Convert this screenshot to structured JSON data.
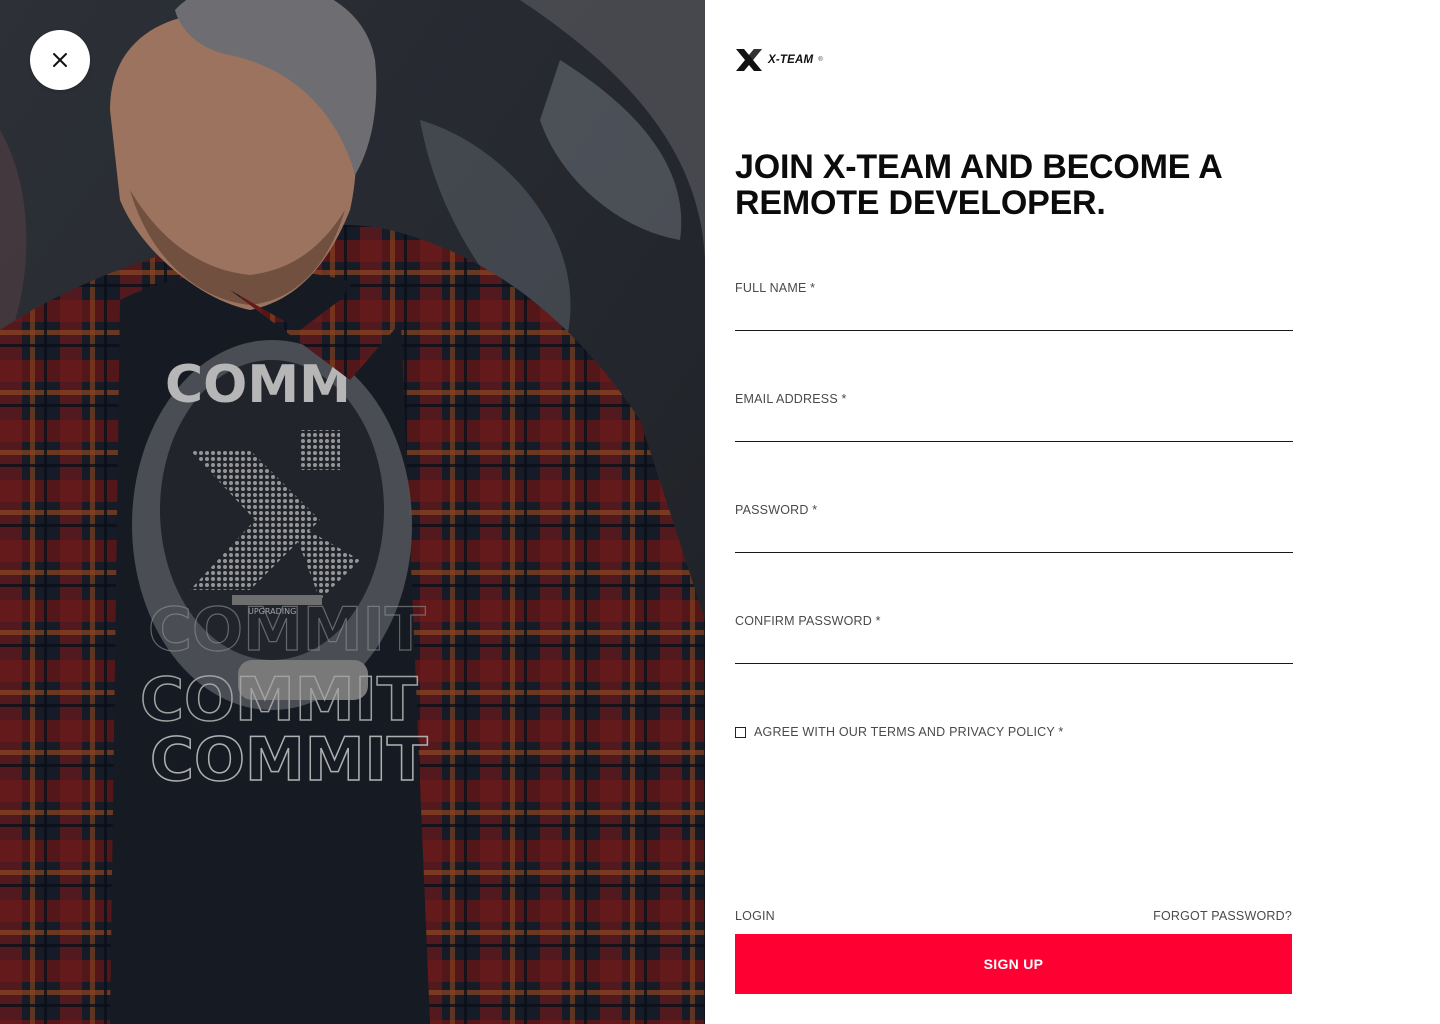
{
  "hero": {
    "photo_icon": "photo-of-developer-in-plaid-shirt",
    "shirt_text": [
      "COMM",
      "COMMIT",
      "COMMIT",
      "COMMIT"
    ],
    "helmet_label": "UPGRADING"
  },
  "close": {
    "icon": "close-icon"
  },
  "brand": {
    "name": "X-TEAM",
    "reg": "®"
  },
  "headline": "JOIN X-TEAM AND BECOME A REMOTE DEVELOPER.",
  "form": {
    "full_name": {
      "label": "FULL NAME *",
      "value": ""
    },
    "email": {
      "label": "EMAIL ADDRESS *",
      "value": ""
    },
    "password": {
      "label": "PASSWORD *",
      "value": ""
    },
    "confirm_password": {
      "label": "CONFIRM PASSWORD *",
      "value": ""
    },
    "agree_label": "AGREE WITH OUR TERMS AND PRIVACY POLICY *",
    "agree_checked": false
  },
  "links": {
    "login": "LOGIN",
    "forgot": "FORGOT PASSWORD?"
  },
  "signup_label": "SIGN UP",
  "colors": {
    "accent": "#ff0033",
    "text": "#0b0b0b",
    "muted": "#4a4a4a"
  }
}
